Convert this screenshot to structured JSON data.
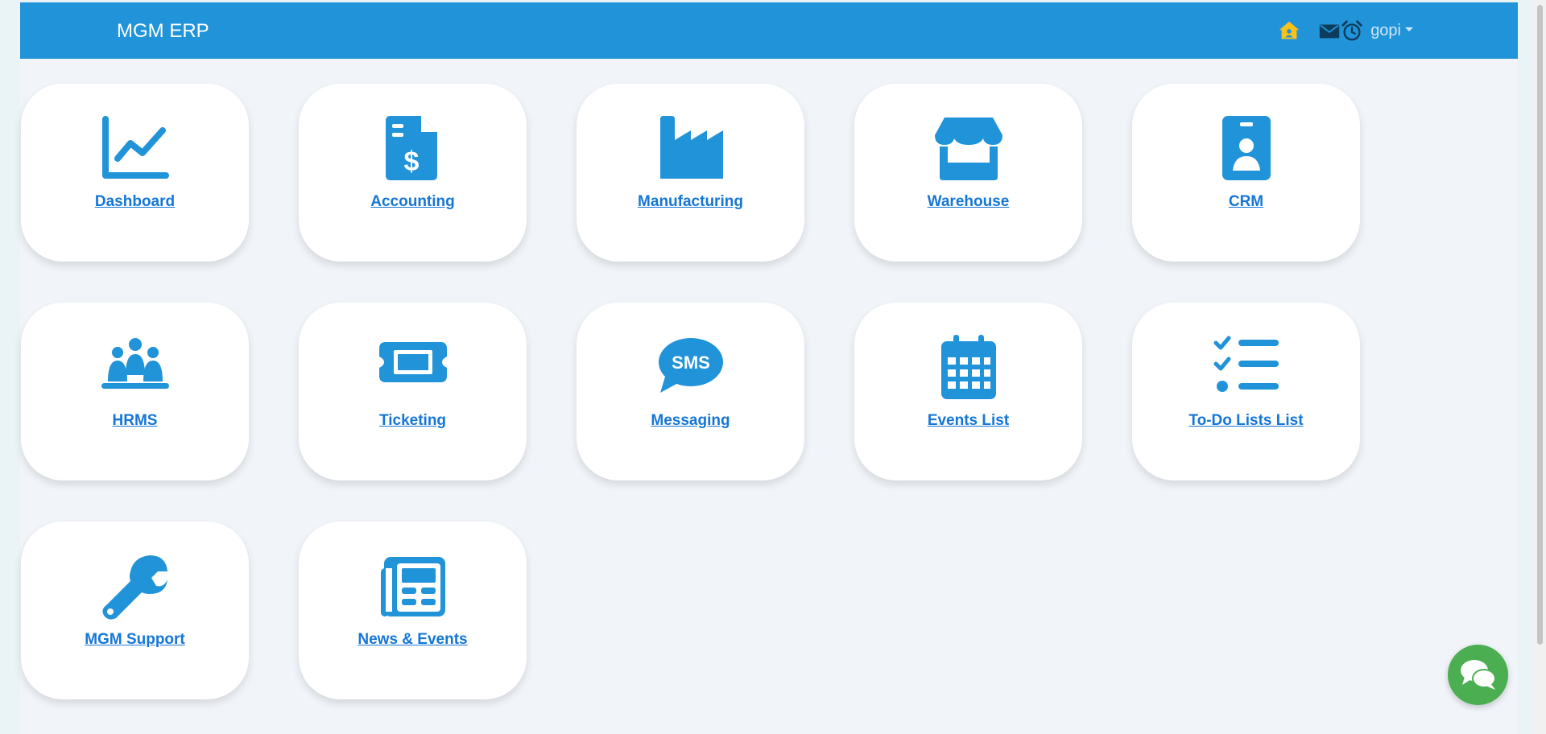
{
  "header": {
    "brand": "MGM ERP",
    "icons": [
      "home-icon",
      "mail-icon",
      "alarm-clock-icon"
    ],
    "user_name": "gopi"
  },
  "modules": [
    {
      "label": "Dashboard",
      "icon": "chart-line-icon"
    },
    {
      "label": "Accounting",
      "icon": "invoice-dollar-icon"
    },
    {
      "label": "Manufacturing",
      "icon": "factory-icon"
    },
    {
      "label": "Warehouse",
      "icon": "store-icon"
    },
    {
      "label": "CRM",
      "icon": "id-badge-icon"
    },
    {
      "label": "HRMS",
      "icon": "people-group-icon"
    },
    {
      "label": "Ticketing",
      "icon": "ticket-icon"
    },
    {
      "label": "Messaging",
      "icon": "sms-icon"
    },
    {
      "label": "Events List",
      "icon": "calendar-icon"
    },
    {
      "label": "To-Do Lists List",
      "icon": "list-check-icon"
    },
    {
      "label": "MGM Support",
      "icon": "wrench-icon"
    },
    {
      "label": "News & Events",
      "icon": "newspaper-icon"
    }
  ],
  "chat_button": {
    "icon": "chat-bubbles-icon"
  },
  "colors": {
    "navbar": "#2193d8",
    "icon_blue": "#2193d8",
    "link_blue": "#1576d6",
    "home_icon": "#f6c21b",
    "chat_green": "#4bae50",
    "page_background": "#f1f5fa"
  }
}
